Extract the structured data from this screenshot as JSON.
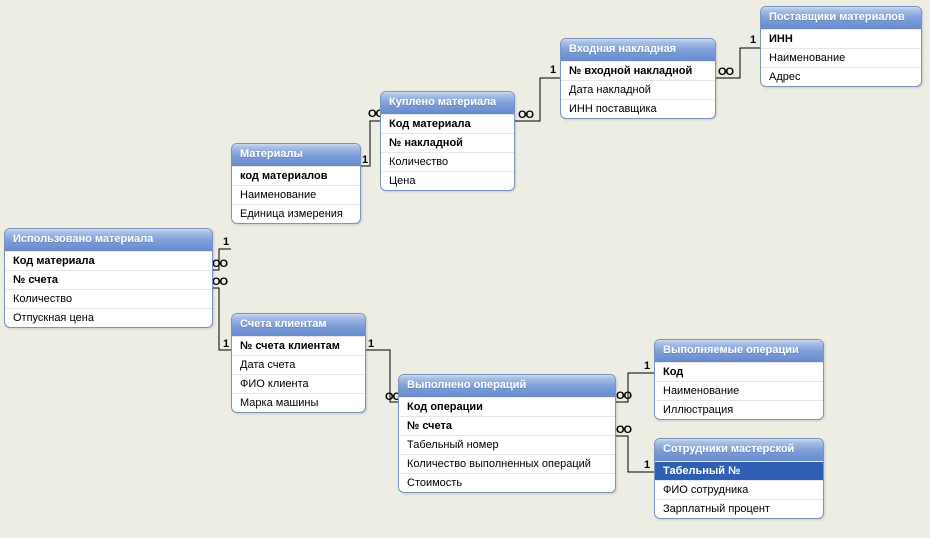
{
  "labels": {
    "one": "1",
    "many": "OO"
  },
  "entities": {
    "used_material": {
      "title": "Использовано материала",
      "fields": [
        {
          "name": "Код материала",
          "pk": true
        },
        {
          "name": "№ счета",
          "pk": true
        },
        {
          "name": "Количество"
        },
        {
          "name": "Отпускная цена"
        }
      ]
    },
    "materials": {
      "title": "Материалы",
      "fields": [
        {
          "name": "код материалов",
          "pk": true
        },
        {
          "name": "Наименование"
        },
        {
          "name": "Единица измерения"
        }
      ]
    },
    "bought_material": {
      "title": "Куплено материала",
      "fields": [
        {
          "name": "Код материала",
          "pk": true
        },
        {
          "name": "№ накладной",
          "pk": true
        },
        {
          "name": "Количество"
        },
        {
          "name": "Цена"
        }
      ]
    },
    "incoming_invoice": {
      "title": "Входная накладная",
      "fields": [
        {
          "name": "№ входной накладной",
          "pk": true
        },
        {
          "name": "Дата накладной"
        },
        {
          "name": "ИНН поставщика"
        }
      ]
    },
    "suppliers": {
      "title": "Поставщики материалов",
      "fields": [
        {
          "name": "ИНН",
          "pk": true
        },
        {
          "name": "Наименование"
        },
        {
          "name": "Адрес"
        }
      ]
    },
    "client_accounts": {
      "title": "Счета клиентам",
      "fields": [
        {
          "name": "№ счета клиентам",
          "pk": true
        },
        {
          "name": "Дата счета"
        },
        {
          "name": "ФИО клиента"
        },
        {
          "name": "Марка машины"
        }
      ]
    },
    "operations_done": {
      "title": "Выполнено операций",
      "fields": [
        {
          "name": "Код операции",
          "pk": true
        },
        {
          "name": "№ счета",
          "pk": true
        },
        {
          "name": "Табельный номер"
        },
        {
          "name": "Количество выполненных операций"
        },
        {
          "name": "Стоимость"
        }
      ]
    },
    "operations": {
      "title": "Выполняемые операции",
      "fields": [
        {
          "name": "Код",
          "pk": true
        },
        {
          "name": "Наименование"
        },
        {
          "name": "Иллюстрация"
        }
      ]
    },
    "employees": {
      "title": "Сотрудники мастерской",
      "fields": [
        {
          "name": "Табельный №",
          "pk": true,
          "selected": true
        },
        {
          "name": "ФИО сотрудника"
        },
        {
          "name": "Зарплатный процент"
        }
      ]
    }
  },
  "relationships": [
    {
      "from": "materials",
      "from_card": "1",
      "to": "used_material",
      "to_card": "many"
    },
    {
      "from": "materials",
      "from_card": "1",
      "to": "bought_material",
      "to_card": "many"
    },
    {
      "from": "incoming_invoice",
      "from_card": "1",
      "to": "bought_material",
      "to_card": "many"
    },
    {
      "from": "suppliers",
      "from_card": "1",
      "to": "incoming_invoice",
      "to_card": "many"
    },
    {
      "from": "client_accounts",
      "from_card": "1",
      "to": "used_material",
      "to_card": "many"
    },
    {
      "from": "client_accounts",
      "from_card": "1",
      "to": "operations_done",
      "to_card": "many"
    },
    {
      "from": "operations",
      "from_card": "1",
      "to": "operations_done",
      "to_card": "many"
    },
    {
      "from": "employees",
      "from_card": "1",
      "to": "operations_done",
      "to_card": "many"
    }
  ]
}
